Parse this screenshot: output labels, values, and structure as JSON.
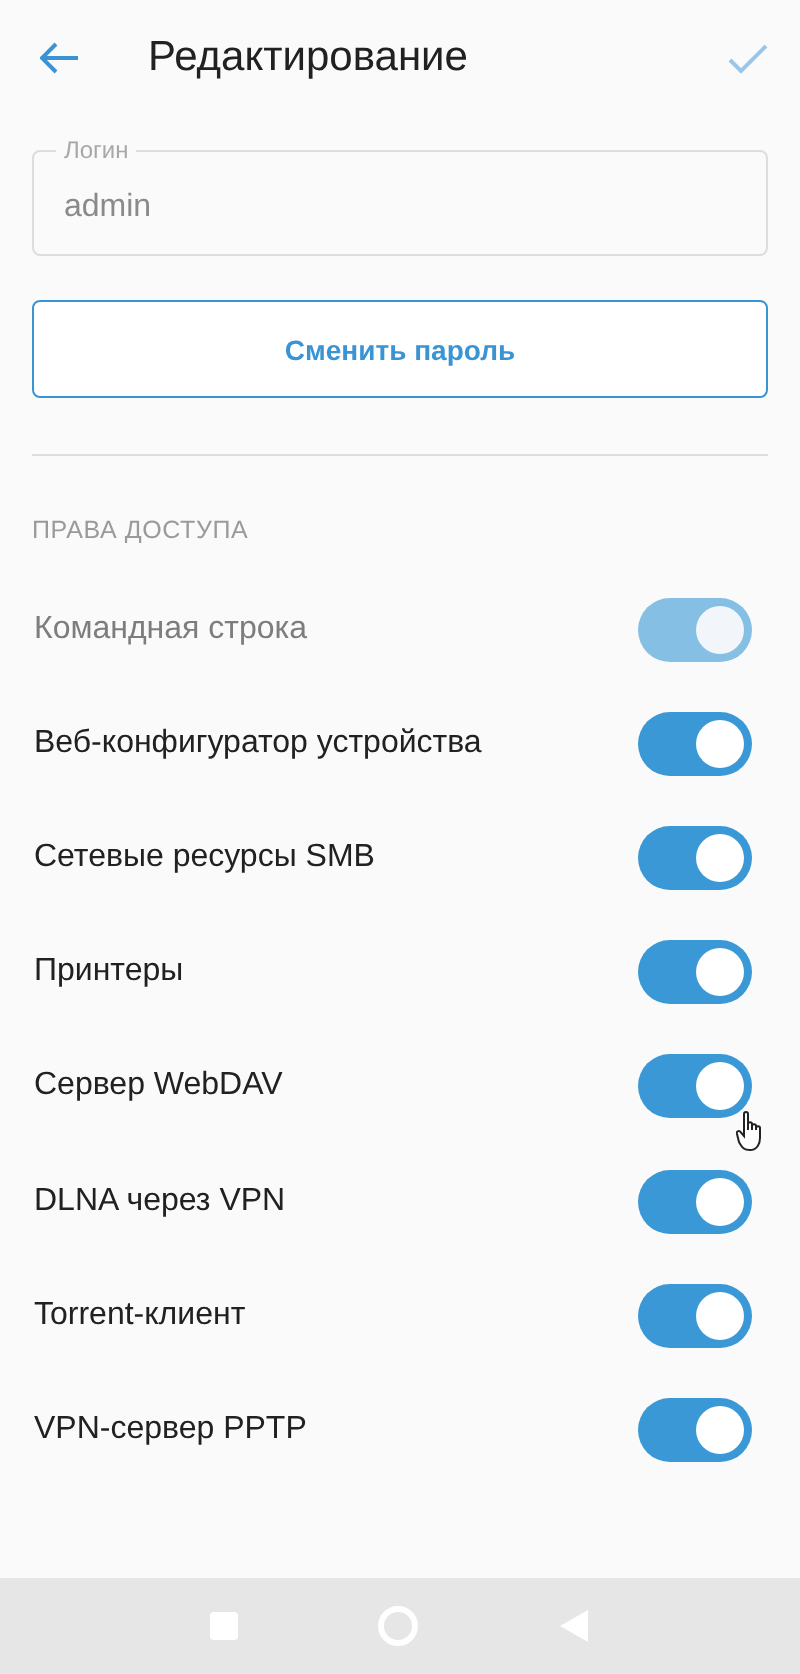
{
  "header": {
    "title": "Редактирование"
  },
  "login_field": {
    "label": "Логин",
    "value": "admin"
  },
  "change_password_button": {
    "label": "Сменить пароль"
  },
  "section": {
    "title": "ПРАВА ДОСТУПА"
  },
  "permissions": [
    {
      "label": "Командная строка",
      "on": true,
      "disabled": true
    },
    {
      "label": "Веб-конфигуратор устройства",
      "on": true,
      "disabled": false
    },
    {
      "label": "Сетевые ресурсы SMB",
      "on": true,
      "disabled": false
    },
    {
      "label": "Принтеры",
      "on": true,
      "disabled": false
    },
    {
      "label": "Сервер WebDAV",
      "on": true,
      "disabled": false,
      "cursor": true
    },
    {
      "label": "DLNA через VPN",
      "on": true,
      "disabled": false
    },
    {
      "label": "Torrent-клиент",
      "on": true,
      "disabled": false
    },
    {
      "label": "VPN-сервер PPTP",
      "on": true,
      "disabled": false
    }
  ]
}
